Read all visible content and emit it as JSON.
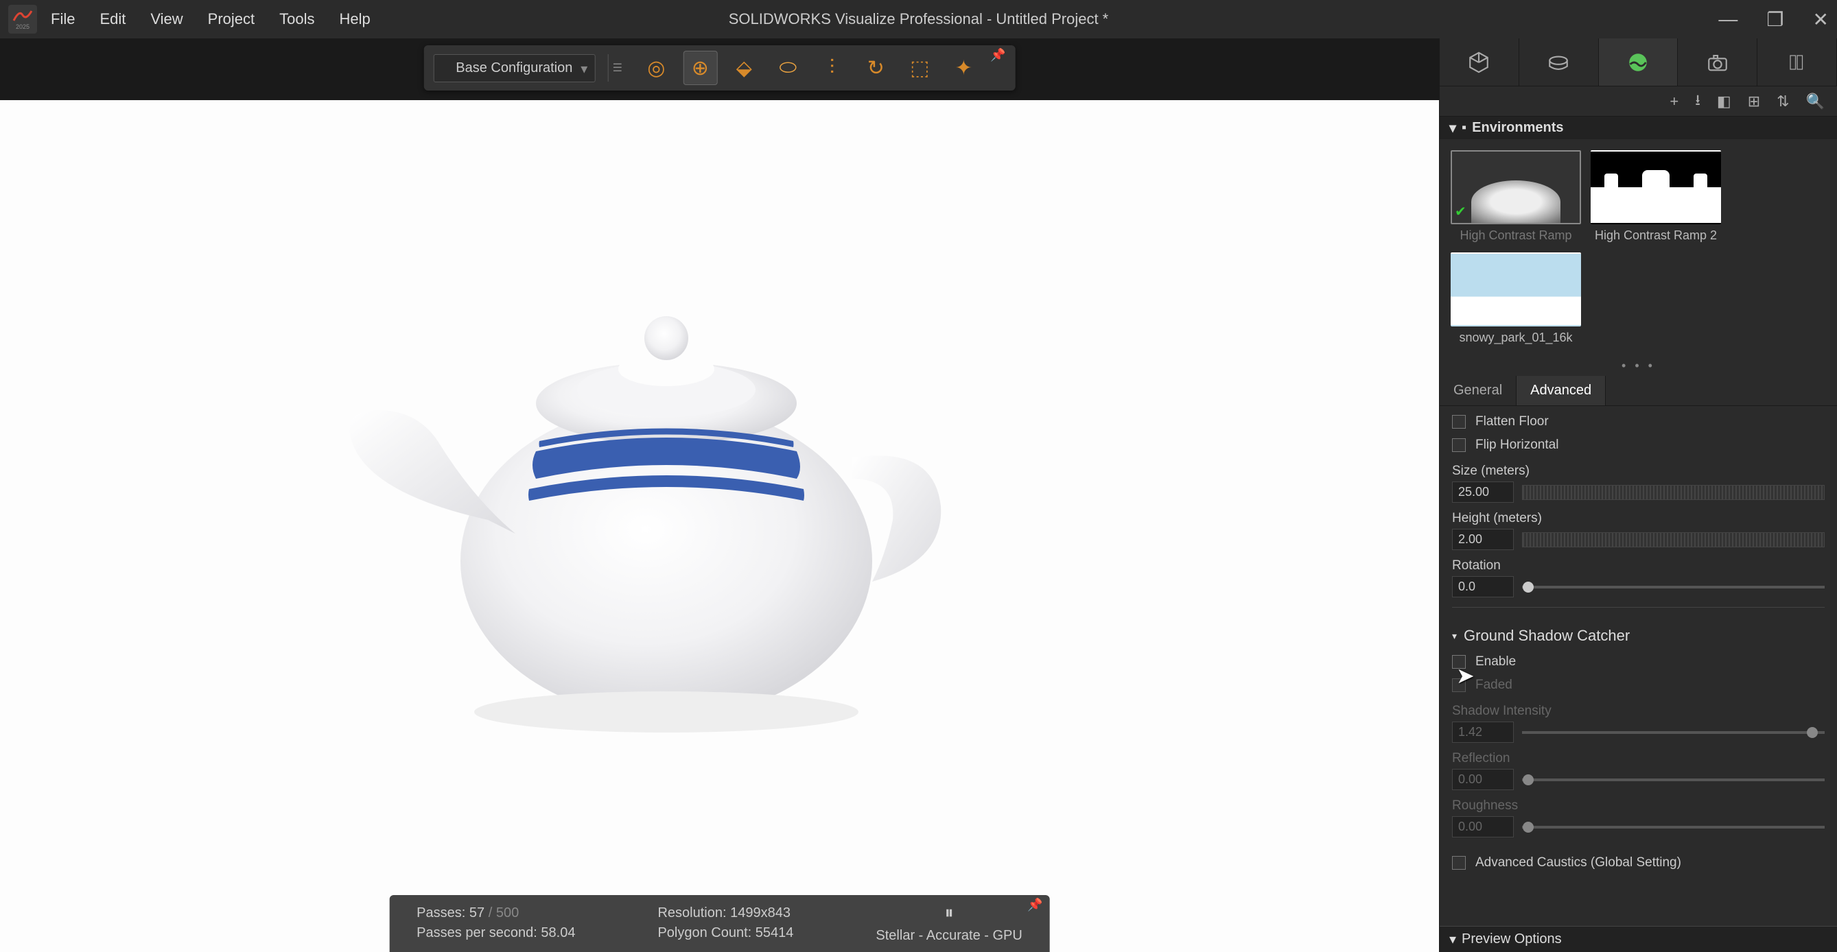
{
  "app": {
    "title": "SOLIDWORKS Visualize Professional - Untitled Project *",
    "year": "2025"
  },
  "menu": {
    "file": "File",
    "edit": "Edit",
    "view": "View",
    "project": "Project",
    "tools": "Tools",
    "help": "Help"
  },
  "toolbar": {
    "config": "Base Configuration"
  },
  "status": {
    "passes_label": "Passes:",
    "passes_current": "57",
    "passes_sep": "/",
    "passes_total": "500",
    "pps_label": "Passes per second:",
    "pps_value": "58.04",
    "resolution_label": "Resolution:",
    "resolution_value": "1499x843",
    "poly_label": "Polygon Count:",
    "poly_value": "55414",
    "renderer": "Stellar - Accurate - GPU"
  },
  "panel": {
    "section_environments": "Environments",
    "env1": "High Contrast Ramp",
    "env2": "High Contrast Ramp 2",
    "env3": "snowy_park_01_16k",
    "tab_general": "General",
    "tab_advanced": "Advanced",
    "flatten_floor": "Flatten Floor",
    "flip_horizontal": "Flip Horizontal",
    "size_label": "Size (meters)",
    "size_value": "25.00",
    "height_label": "Height (meters)",
    "height_value": "2.00",
    "rotation_label": "Rotation",
    "rotation_value": "0.0",
    "ground_shadow": "Ground Shadow Catcher",
    "enable": "Enable",
    "faded": "Faded",
    "shadow_intensity": "Shadow Intensity",
    "shadow_intensity_value": "1.42",
    "reflection": "Reflection",
    "reflection_value": "0.00",
    "roughness": "Roughness",
    "roughness_value": "0.00",
    "advanced_caustics": "Advanced Caustics (Global Setting)",
    "preview_options": "Preview Options"
  }
}
